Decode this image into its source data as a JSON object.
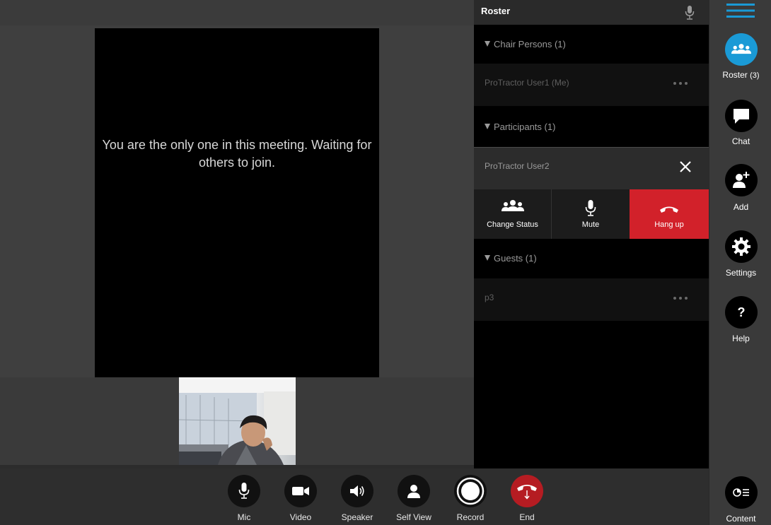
{
  "stage": {
    "waiting_message": "You are the only one in this meeting. Waiting for others to join."
  },
  "roster": {
    "title": "Roster",
    "sections": {
      "chair": {
        "label": "Chair Persons (1)",
        "members": [
          {
            "name": "ProTractor User1 (Me)"
          }
        ]
      },
      "participants": {
        "label": "Participants (1)",
        "members": [
          {
            "name": "ProTractor User2"
          }
        ]
      },
      "guests": {
        "label": "Guests (1)",
        "members": [
          {
            "name": "p3"
          }
        ]
      }
    },
    "actions": {
      "change_status": "Change Status",
      "mute": "Mute",
      "hang_up": "Hang up"
    }
  },
  "sidebar": {
    "roster_label": "Roster",
    "roster_count": "(3)",
    "chat": "Chat",
    "add": "Add",
    "settings": "Settings",
    "help": "Help",
    "help_glyph": "?",
    "content": "Content"
  },
  "controls": {
    "mic": "Mic",
    "video": "Video",
    "speaker": "Speaker",
    "self_view": "Self View",
    "record": "Record",
    "end": "End"
  },
  "colors": {
    "accent": "#1a9ad6",
    "hangup": "#d2212a",
    "end": "#b51c22"
  }
}
